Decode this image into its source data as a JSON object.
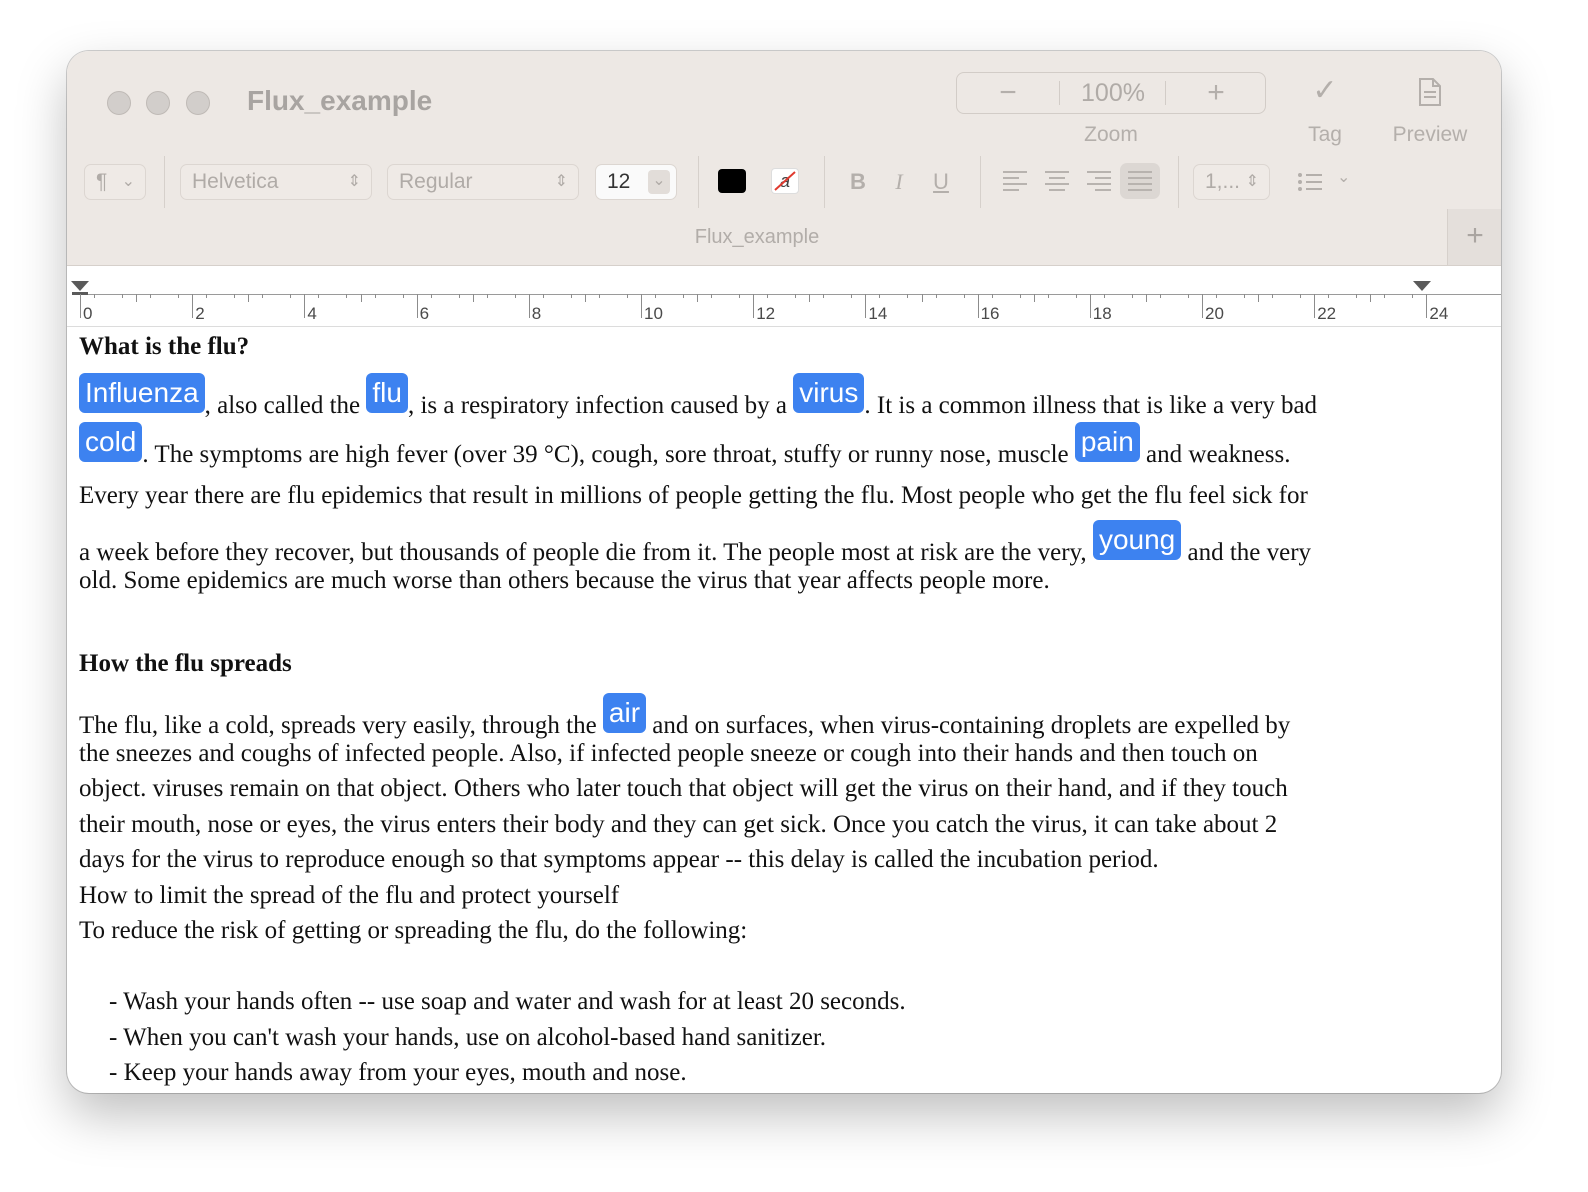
{
  "window": {
    "title": "Flux_example",
    "doc_tab": "Flux_example",
    "tab_add": "+"
  },
  "toolbar": {
    "zoom_out": "−",
    "zoom_value": "100%",
    "zoom_in": "+",
    "zoom_label": "Zoom",
    "tag_icon": "✓",
    "tag_label": "Tag",
    "preview_label": "Preview"
  },
  "format_bar": {
    "paragraph_style": "¶",
    "font_family": "Helvetica",
    "font_style": "Regular",
    "font_size": "12",
    "bold": "B",
    "italic": "I",
    "underline": "U",
    "line_spacing": "1,...",
    "text_color": "#000000",
    "list_icon": "list-bullets-icon"
  },
  "ruler": {
    "labels": [
      "0",
      "2",
      "4",
      "6",
      "8",
      "10",
      "12",
      "14",
      "16",
      "18",
      "20",
      "22",
      "24"
    ]
  },
  "document": {
    "h1": "What is the flu?",
    "p1": {
      "t1": "Influenza",
      "s1": ", also called the ",
      "t2": "flu",
      "s2": ", is a respiratory infection caused by a ",
      "t3": "virus",
      "s3": ". It is a common illness that is like a very bad",
      "t4": "cold",
      "s4": ". The symptoms are high fever (over 39 °C), cough, sore throat, stuffy or runny nose, muscle ",
      "t5": "pain",
      "s5": " and weakness."
    },
    "p2": {
      "l1": "Every year there are flu epidemics that result in millions of people getting the flu. Most people who get the flu feel sick for",
      "l2a": "a week before they recover, but thousands of people die from it. The people most at risk are the very, ",
      "t6": "young",
      "l2b": " and the very",
      "l3": "old. Some epidemics are much worse than others because the virus that year affects people more."
    },
    "h2": "How the flu spreads",
    "p3": {
      "l1a": "The flu, like a cold, spreads very easily, through the ",
      "t7": "air",
      "l1b": " and on surfaces, when virus-containing droplets are expelled by",
      "l2": "the sneezes and coughs of infected people. Also, if infected people sneeze or cough into their hands and then touch on",
      "l3": "object. viruses remain on that object. Others who later touch that object will get the virus on their hand, and if they touch",
      "l4": "their mouth, nose or eyes, the virus enters their body and they can get sick. Once you catch the virus, it can take about 2",
      "l5": "days for the virus to reproduce enough so that symptoms appear -- this delay is called the incubation period."
    },
    "p4": "How to limit the spread of the flu and protect yourself",
    "p5": " To reduce the risk of getting or spreading the flu, do the following:",
    "bullets": [
      "- Wash your hands often -- use soap and water and wash for at least 20 seconds.",
      "- When you can't wash your hands, use on alcohol-based hand sanitizer.",
      "- Keep your hands away from your eyes, mouth and nose."
    ]
  }
}
